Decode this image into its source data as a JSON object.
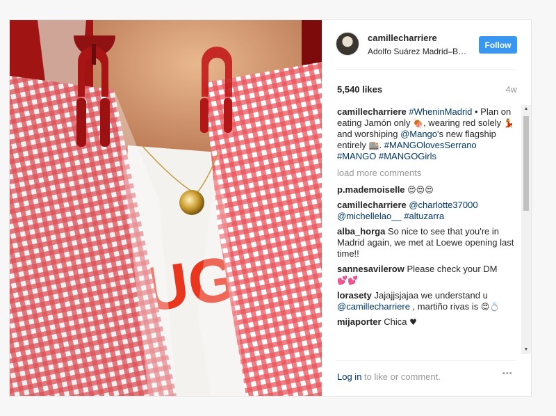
{
  "post": {
    "username": "camillecharriere",
    "location": "Adolfo Suárez Madrid–B…",
    "follow_label": "Follow",
    "likes": "5,540 likes",
    "time_ago": "4w",
    "caption": {
      "user": "camillecharriere",
      "hashtag1": "#WheninMadrid",
      "text1": " • Plan on eating Jamón only ",
      "emoji1": "🍖",
      "text2": ", wearing red solely ",
      "emoji2": "💃",
      "text3": " and worshiping ",
      "mention": "@Mango",
      "text4": "'s new flagship entirely ",
      "emoji3": "🏬",
      "text5": ". ",
      "hashtag2": "#MANGOlovesSerrano",
      "hashtag3": "#MANGO",
      "hashtag4": "#MANGOGirls"
    },
    "load_more": "load more comments",
    "comments": [
      {
        "user": "p.mademoiselle",
        "text": "",
        "emoji": "😍😍😍"
      },
      {
        "user": "camillecharriere",
        "mention1": "@charlotte37000",
        "mention2": "@michellelao__",
        "hashtag": "#altuzarra"
      },
      {
        "user": "alba_horga",
        "text": "So nice to see that you're in Madrid again, we met at Loewe opening last time!!"
      },
      {
        "user": "sannesavilerow",
        "text": "Please check your DM",
        "emoji": "💕💕"
      },
      {
        "user": "lorasety",
        "text": "Jajajjsjajaa we understand u",
        "mention": "@camillecharriere",
        "text2": " , martiño rivas is ",
        "emoji": "😍💍"
      },
      {
        "user": "mijaporter",
        "text": "Chica",
        "emoji": "♥"
      }
    ],
    "footer": {
      "login_link": "Log in",
      "login_text": " to like or comment.",
      "more_icon": "•••"
    }
  },
  "icons": {
    "more": "ellipsis-icon",
    "avatar": "avatar"
  },
  "colors": {
    "accent": "#3897f0",
    "link": "#003569",
    "muted": "#999999"
  }
}
